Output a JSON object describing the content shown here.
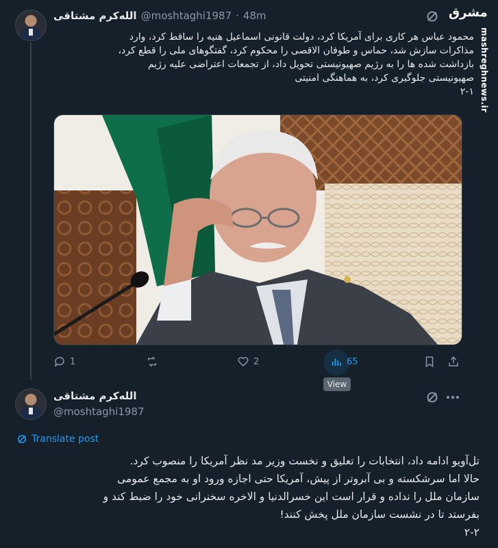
{
  "tweet1": {
    "author_name": "الله‌کرم مشتاقی",
    "handle": "@moshtaghi1987",
    "separator": "·",
    "time": "48m",
    "text": "محمود عباس هر کاری برای آمریکا کرد، دولت قانونی اسماعیل هنیه را ساقط کرد، وارد\nمذاکرات سازش شد، حماس و طوفان الاقصی را محکوم کرد، گفتگوهای ملی را قطع کرد،\nبازداشت شده ها را به رژیم صهیونیستی تحویل داد، از تجمعات اعتراضی علیه رژیم\nصهیونیستی جلوگیری کرد، به هماهنگی امنیتی\n۲-۱",
    "actions": {
      "reply_count": "1",
      "retweet_count": "",
      "like_count": "2",
      "views_count": "65"
    },
    "tooltip": "View"
  },
  "tweet2": {
    "author_name": "الله‌کرم مشتاقی",
    "handle": "@moshtaghi1987",
    "translate_label": "Translate post",
    "text": "تل‌آویو ادامه داد، انتخابات را تعلیق و نخست وزیر مد نظر آمریکا را منصوب کرد.\nحالا اما سرشکسته و بی آبروتر از پیش، آمریکا حتی اجازه ورود او به مجمع عمومی\nسازمان ملل را نداده و قرار است این خسرالدنیا و الاخره سخنرانی خود را ضبط کند و\nبفرستد تا در نشست سازمان ملل پخش کنند!\n۲-۲"
  },
  "watermark": {
    "logo": "مشرق",
    "side_text": "mashreghnews.ir"
  },
  "colors": {
    "background": "#15202b",
    "accent": "#1d9bf0",
    "muted": "#8b98a5"
  }
}
